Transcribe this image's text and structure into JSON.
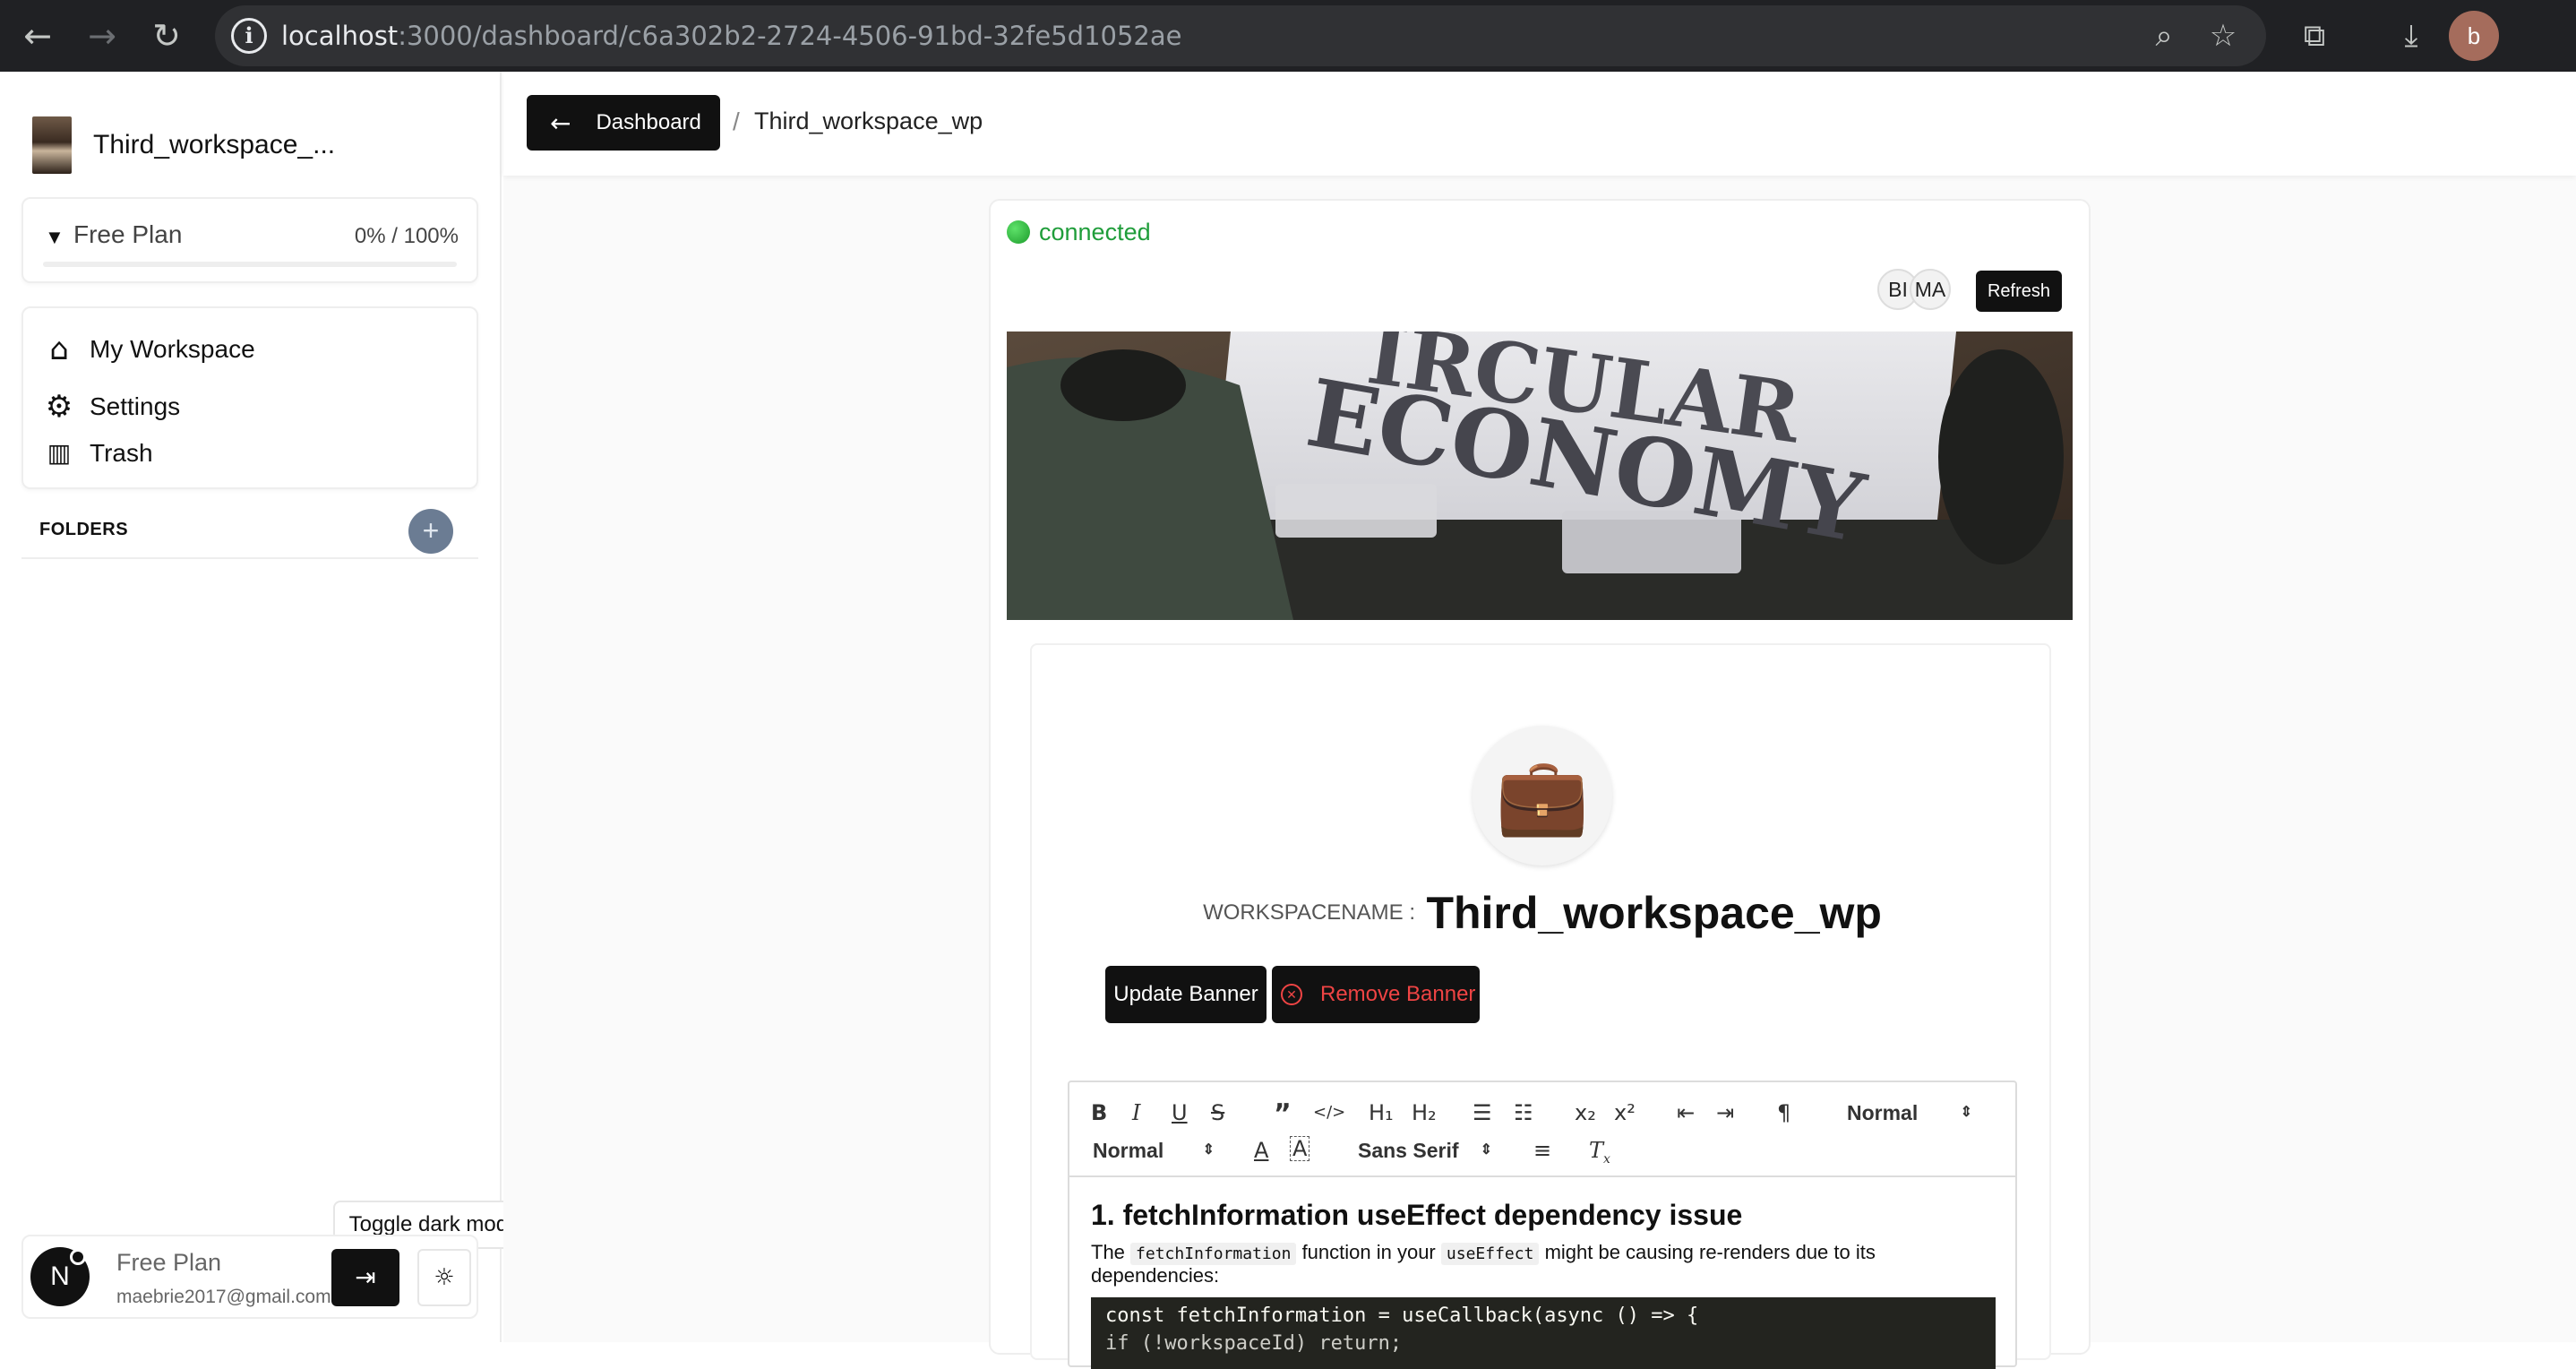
{
  "browser": {
    "url_host": "localhost",
    "url_path": ":3000/dashboard/c6a302b2-2724-4506-91bd-32fe5d1052ae",
    "profile_initial": "b",
    "icons": [
      "back-arrow",
      "forward-arrow",
      "reload",
      "site-info",
      "zoom",
      "bookmark-star",
      "extensions",
      "download"
    ]
  },
  "sidebar": {
    "workspace_title": "Third_workspace_...",
    "plan": {
      "label": "Free Plan",
      "usage": "0% / 100%",
      "usage_fraction": 0
    },
    "nav": [
      {
        "label": "My Workspace",
        "icon": "home-icon"
      },
      {
        "label": "Settings",
        "icon": "gear-icon"
      },
      {
        "label": "Trash",
        "icon": "trash-icon"
      }
    ],
    "folders_label": "FOLDERS",
    "tooltip": "Toggle dark mode",
    "user": {
      "initial": "N",
      "plan": "Free Plan",
      "email": "maebrie2017@gmail.com"
    }
  },
  "topbar": {
    "back_label": "Dashboard",
    "separator": "/",
    "current": "Third_workspace_wp"
  },
  "page": {
    "status": "connected",
    "collaborators": [
      "BI",
      "MA"
    ],
    "refresh_label": "Refresh",
    "banner_text": [
      "IRCULAR",
      "ECONOMY"
    ],
    "workspace_label": "WORKSPACENAME :",
    "workspace_name": "Third_workspace_wp",
    "update_banner_label": "Update Banner",
    "remove_banner_label": "Remove Banner"
  },
  "editor": {
    "toolbar": {
      "bold": "B",
      "italic": "I",
      "underline": "U",
      "strike": "S",
      "quote": "”",
      "code": "</>",
      "h1": "H₁",
      "h2": "H₂",
      "subscript": "x₂",
      "superscript": "x²",
      "header_select": "Normal",
      "size_select": "Normal",
      "font_select": "Sans Serif"
    },
    "content": {
      "heading": "1. fetchInformation useEffect dependency issue",
      "p_before": "The",
      "code1": "fetchInformation",
      "p_middle": "function in your",
      "code2": "useEffect",
      "p_after": "might be causing re-renders due to its dependencies:",
      "code_line1": "const fetchInformation = useCallback(async () => {",
      "code_line2": "  if (!workspaceId) return;"
    }
  }
}
